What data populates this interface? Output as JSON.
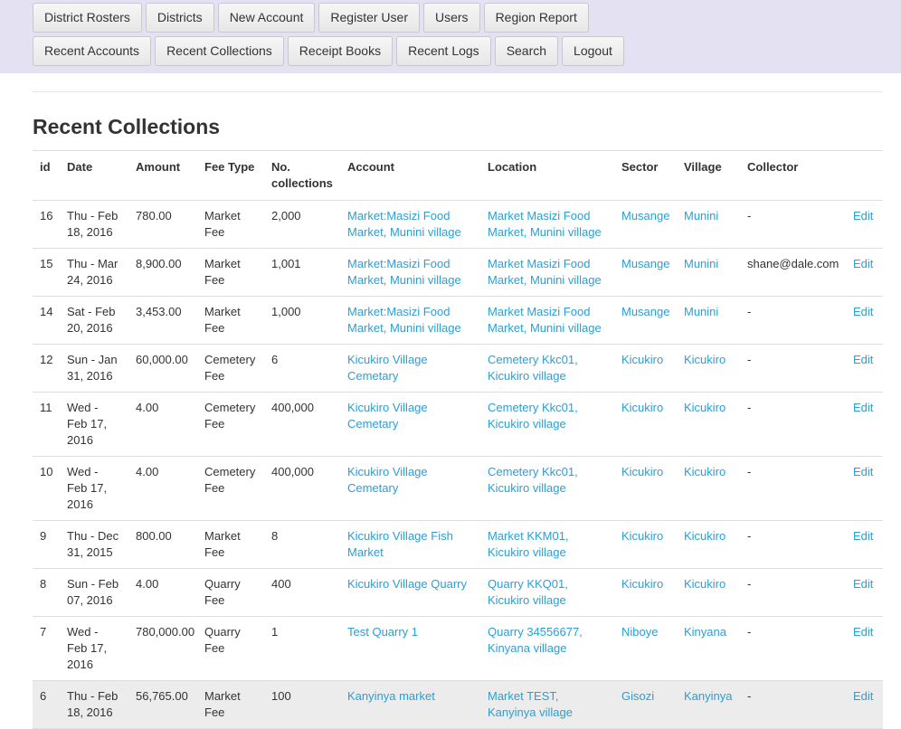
{
  "nav": {
    "row1": [
      "District Rosters",
      "Districts",
      "New Account",
      "Register User",
      "Users",
      "Region Report"
    ],
    "row2": [
      "Recent Accounts",
      "Recent Collections",
      "Receipt Books",
      "Recent Logs",
      "Search",
      "Logout"
    ]
  },
  "page_title": "Recent Collections",
  "table": {
    "headers": [
      "id",
      "Date",
      "Amount",
      "Fee Type",
      "No. collections",
      "Account",
      "Location",
      "Sector",
      "Village",
      "Collector",
      ""
    ],
    "edit_label": "Edit",
    "rows": [
      {
        "id": "16",
        "date": "Thu - Feb 18, 2016",
        "amount": "780.00",
        "fee_type": "Market Fee",
        "collections": "2,000",
        "account": "Market:Masizi Food Market, Munini village",
        "location": "Market Masizi Food Market, Munini village",
        "sector": "Musange",
        "village": "Munini",
        "collector": "-"
      },
      {
        "id": "15",
        "date": "Thu - Mar 24, 2016",
        "amount": "8,900.00",
        "fee_type": "Market Fee",
        "collections": "1,001",
        "account": "Market:Masizi Food Market, Munini village",
        "location": "Market Masizi Food Market, Munini village",
        "sector": "Musange",
        "village": "Munini",
        "collector": "shane@dale.com"
      },
      {
        "id": "14",
        "date": "Sat - Feb 20, 2016",
        "amount": "3,453.00",
        "fee_type": "Market Fee",
        "collections": "1,000",
        "account": "Market:Masizi Food Market, Munini village",
        "location": "Market Masizi Food Market, Munini village",
        "sector": "Musange",
        "village": "Munini",
        "collector": "-"
      },
      {
        "id": "12",
        "date": "Sun - Jan 31, 2016",
        "amount": "60,000.00",
        "fee_type": "Cemetery Fee",
        "collections": "6",
        "account": "Kicukiro Village Cemetary",
        "location": "Cemetery Kkc01, Kicukiro village",
        "sector": "Kicukiro",
        "village": "Kicukiro",
        "collector": "-"
      },
      {
        "id": "11",
        "date": "Wed - Feb 17, 2016",
        "amount": "4.00",
        "fee_type": "Cemetery Fee",
        "collections": "400,000",
        "account": "Kicukiro Village Cemetary",
        "location": "Cemetery Kkc01, Kicukiro village",
        "sector": "Kicukiro",
        "village": "Kicukiro",
        "collector": "-"
      },
      {
        "id": "10",
        "date": "Wed - Feb 17, 2016",
        "amount": "4.00",
        "fee_type": "Cemetery Fee",
        "collections": "400,000",
        "account": "Kicukiro Village Cemetary",
        "location": "Cemetery Kkc01, Kicukiro village",
        "sector": "Kicukiro",
        "village": "Kicukiro",
        "collector": "-"
      },
      {
        "id": "9",
        "date": "Thu - Dec 31, 2015",
        "amount": "800.00",
        "fee_type": "Market Fee",
        "collections": "8",
        "account": "Kicukiro Village Fish Market",
        "location": "Market KKM01, Kicukiro village",
        "sector": "Kicukiro",
        "village": "Kicukiro",
        "collector": "-"
      },
      {
        "id": "8",
        "date": "Sun - Feb 07, 2016",
        "amount": "4.00",
        "fee_type": "Quarry Fee",
        "collections": "400",
        "account": "Kicukiro Village Quarry",
        "location": "Quarry KKQ01, Kicukiro village",
        "sector": "Kicukiro",
        "village": "Kicukiro",
        "collector": "-"
      },
      {
        "id": "7",
        "date": "Wed - Feb 17, 2016",
        "amount": "780,000.00",
        "fee_type": "Quarry Fee",
        "collections": "1",
        "account": "Test Quarry 1",
        "location": "Quarry 34556677, Kinyana village",
        "sector": "Niboye",
        "village": "Kinyana",
        "collector": "-"
      },
      {
        "id": "6",
        "date": "Thu - Feb 18, 2016",
        "amount": "56,765.00",
        "fee_type": "Market Fee",
        "collections": "100",
        "account": "Kanyinya market",
        "location": "Market TEST, Kanyinya village",
        "sector": "Gisozi",
        "village": "Kanyinya",
        "collector": "-"
      }
    ]
  },
  "colors": {
    "nav_bg": "#e3e1f2",
    "link": "#2a9fd6",
    "row_highlight": "#ececec"
  }
}
